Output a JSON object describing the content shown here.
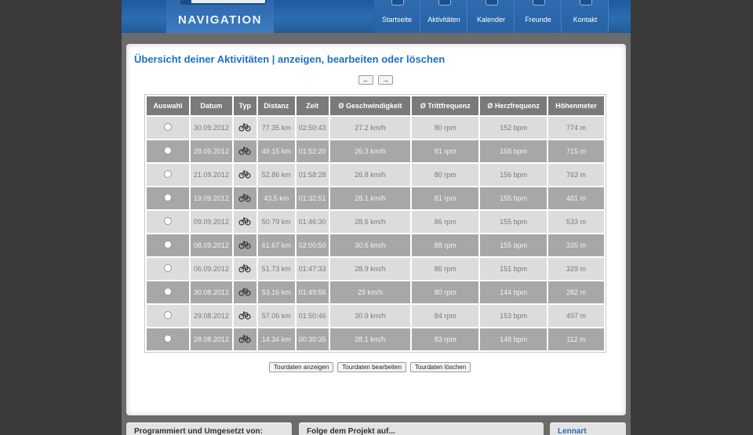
{
  "brand": {
    "title": "NAVIGATION"
  },
  "nav": [
    {
      "label": "Startseite",
      "icon": "home-icon"
    },
    {
      "label": "Aktivitäten",
      "icon": "activity-icon"
    },
    {
      "label": "Kalender",
      "icon": "calendar-icon"
    },
    {
      "label": "Freunde",
      "icon": "friends-icon"
    },
    {
      "label": "Kontakt",
      "icon": "contact-icon"
    }
  ],
  "page": {
    "title": "Übersicht deiner Aktivitäten | anzeigen, bearbeiten oder löschen"
  },
  "pager": {
    "prev": "←",
    "next": "→"
  },
  "table": {
    "headers": [
      "Auswahl",
      "Datum",
      "Typ",
      "Distanz",
      "Zeit",
      "Ø Geschwindigkeit",
      "Ø Trittfrequenz",
      "Ø Herzfrequenz",
      "Höhenmeter"
    ],
    "rows": [
      {
        "date": "30.09.2012",
        "type": "bike-icon",
        "distance": "77.35 km",
        "time": "02:50:43",
        "speed": "27.2 km/h",
        "cadence": "80 rpm",
        "heart": "152 bpm",
        "elevation": "774 m"
      },
      {
        "date": "28.09.2012",
        "type": "bike-icon",
        "distance": "49.15 km",
        "time": "01:52:20",
        "speed": "26.3 km/h",
        "cadence": "81 rpm",
        "heart": "158 bpm",
        "elevation": "715 m"
      },
      {
        "date": "21.09.2012",
        "type": "bike-icon",
        "distance": "52.86 km",
        "time": "01:58:28",
        "speed": "26.8 km/h",
        "cadence": "80 rpm",
        "heart": "156 bpm",
        "elevation": "763 m"
      },
      {
        "date": "19.09.2012",
        "type": "bike-icon",
        "distance": "43.5 km",
        "time": "01:32:51",
        "speed": "28.1 km/h",
        "cadence": "81 rpm",
        "heart": "155 bpm",
        "elevation": "481 m"
      },
      {
        "date": "09.09.2012",
        "type": "bike-icon",
        "distance": "50.79 km",
        "time": "01:46:30",
        "speed": "28.6 km/h",
        "cadence": "86 rpm",
        "heart": "155 bpm",
        "elevation": "533 m"
      },
      {
        "date": "08.09.2012",
        "type": "bike-icon",
        "distance": "61.67 km",
        "time": "02:00:50",
        "speed": "30.6 km/h",
        "cadence": "88 rpm",
        "heart": "155 bpm",
        "elevation": "335 m"
      },
      {
        "date": "06.09.2012",
        "type": "bike-icon",
        "distance": "51.73 km",
        "time": "01:47:33",
        "speed": "28.9 km/h",
        "cadence": "86 rpm",
        "heart": "151 bpm",
        "elevation": "329 m"
      },
      {
        "date": "30.08.2012",
        "type": "bike-icon",
        "distance": "53.16 km",
        "time": "01:49:56",
        "speed": "29 km/h",
        "cadence": "80 rpm",
        "heart": "144 bpm",
        "elevation": "282 m"
      },
      {
        "date": "29.08.2012",
        "type": "bike-icon",
        "distance": "57.06 km",
        "time": "01:50:46",
        "speed": "30.9 km/h",
        "cadence": "84 rpm",
        "heart": "153 bpm",
        "elevation": "497 m"
      },
      {
        "date": "28.08.2012",
        "type": "bike-icon",
        "distance": "14.34 km",
        "time": "00:30:35",
        "speed": "28.1 km/h",
        "cadence": "83 rpm",
        "heart": "148 bpm",
        "elevation": "112 m"
      }
    ]
  },
  "actions": {
    "show": "Tourdaten anzeigen",
    "edit": "Tourdaten bearbeiten",
    "delete": "Tourdaten löschen"
  },
  "footer": {
    "credits": "Programmiert und Umgesetzt von:",
    "follow": "Folge dem Projekt auf...",
    "user": "Lennart"
  },
  "colors": {
    "accent": "#1f6fc0",
    "header": "#2b6db3",
    "row_light": "#dcdcdc",
    "row_dark": "#a7a7a7"
  }
}
